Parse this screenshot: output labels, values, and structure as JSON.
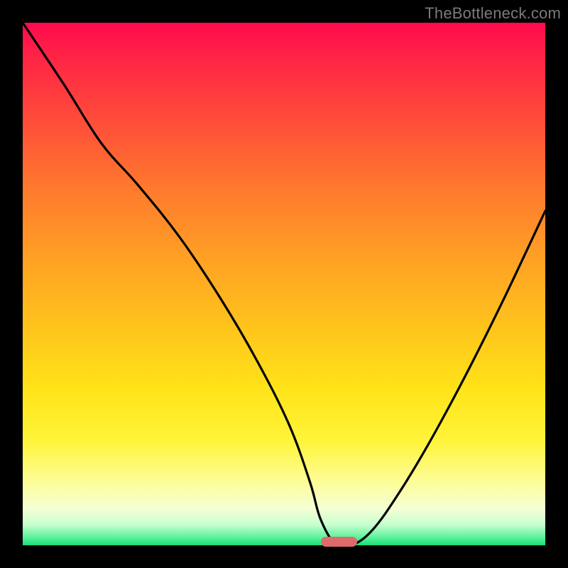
{
  "watermark": "TheBottleneck.com",
  "chart_data": {
    "type": "line",
    "title": "",
    "xlabel": "",
    "ylabel": "",
    "xlim": [
      0,
      100
    ],
    "ylim": [
      0,
      100
    ],
    "grid": false,
    "legend": "none",
    "series": [
      {
        "name": "bottleneck-curve",
        "x": [
          0,
          8,
          15,
          22,
          30,
          38,
          45,
          51,
          55,
          57,
          60,
          63,
          67,
          72,
          78,
          85,
          92,
          100
        ],
        "values": [
          100,
          88,
          77,
          69,
          59,
          47,
          35,
          23,
          12,
          5,
          0,
          0,
          3,
          10,
          20,
          33,
          47,
          64
        ]
      }
    ],
    "marker": {
      "x_start": 57,
      "x_end": 64,
      "y": 0
    },
    "gradient_stops": [
      {
        "pct": 0,
        "color": "#ff0a4d"
      },
      {
        "pct": 18,
        "color": "#ff4a3a"
      },
      {
        "pct": 45,
        "color": "#ffa024"
      },
      {
        "pct": 70,
        "color": "#ffe318"
      },
      {
        "pct": 93,
        "color": "#f4ffd4"
      },
      {
        "pct": 100,
        "color": "#17e07a"
      }
    ]
  }
}
